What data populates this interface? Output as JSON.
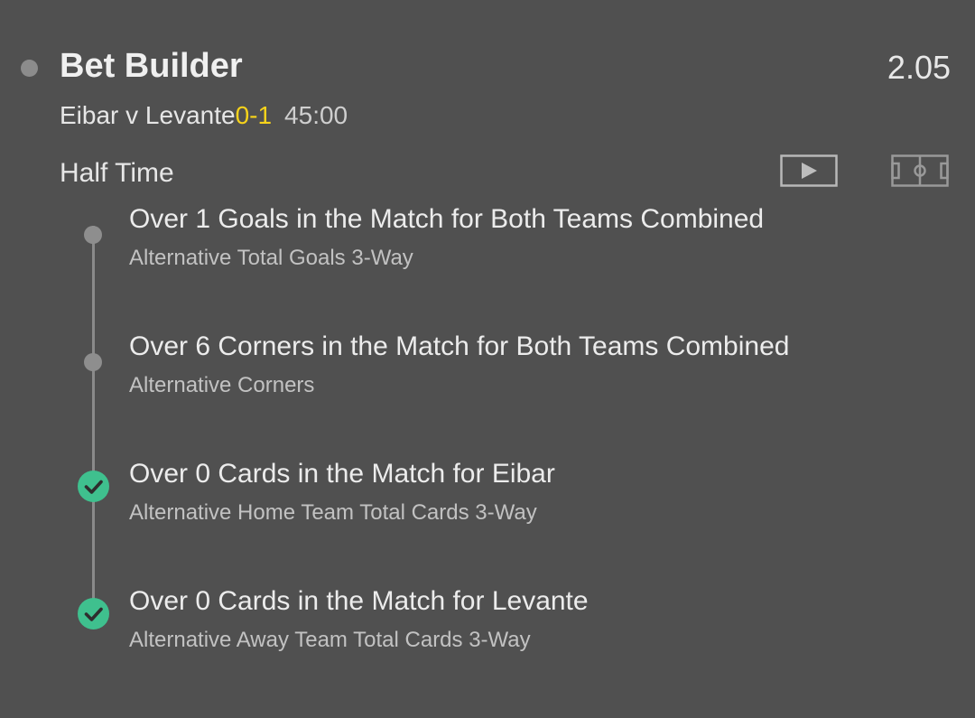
{
  "header": {
    "title": "Bet Builder",
    "odds": "2.05"
  },
  "match": {
    "name": "Eibar v Levante",
    "score": "0-1",
    "time": "45:00"
  },
  "period": "Half Time",
  "icons": {
    "video": "video-play-icon",
    "pitch": "pitch-icon"
  },
  "colors": {
    "score": "#f7d31b",
    "won": "#3fc08e",
    "pending": "#8e8e8e",
    "background": "#505050"
  },
  "legs": [
    {
      "selection": "Over 1 Goals in the Match for Both Teams Combined",
      "market": "Alternative Total Goals 3-Way",
      "status": "pending"
    },
    {
      "selection": "Over 6 Corners in the Match for Both Teams Combined",
      "market": "Alternative Corners",
      "status": "pending"
    },
    {
      "selection": "Over 0 Cards in the Match for Eibar",
      "market": "Alternative Home Team Total Cards 3-Way",
      "status": "won"
    },
    {
      "selection": "Over 0 Cards in the Match for Levante",
      "market": "Alternative Away Team Total Cards 3-Way",
      "status": "won"
    }
  ]
}
